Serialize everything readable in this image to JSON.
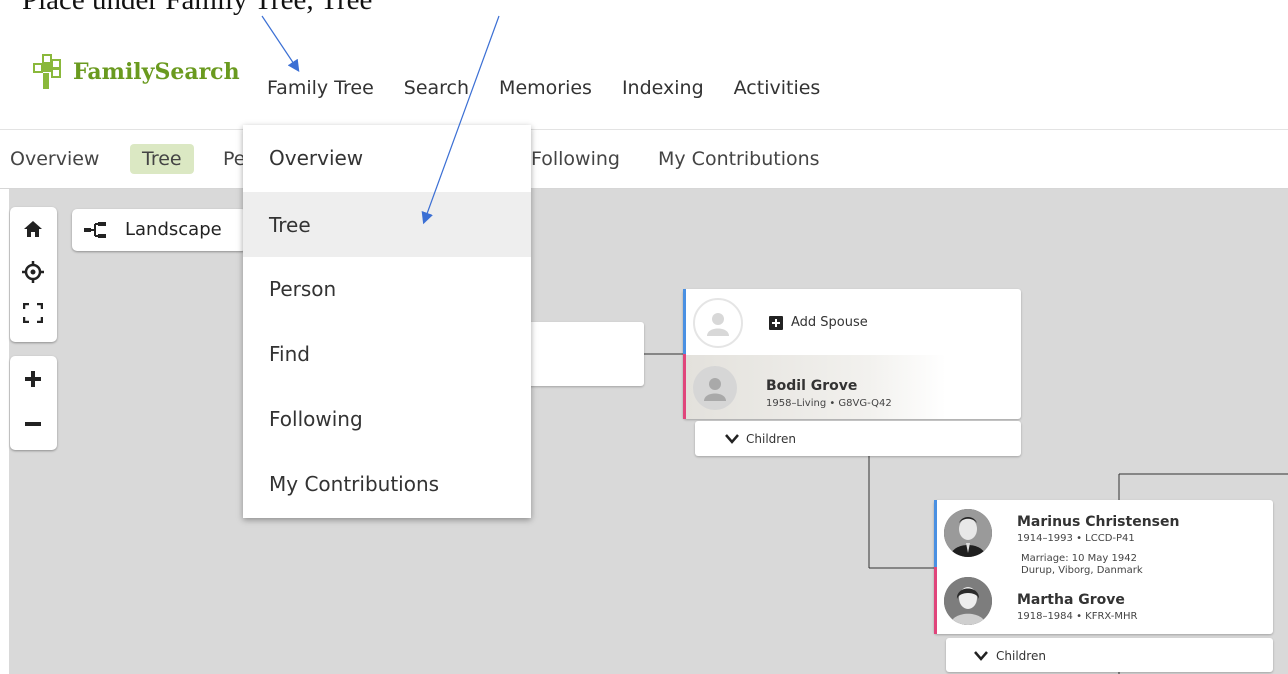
{
  "instruction": "Place under Family Tree, Tree",
  "logo": {
    "text": "FamilySearch"
  },
  "nav": [
    "Family Tree",
    "Search",
    "Memories",
    "Indexing",
    "Activities"
  ],
  "subnav": {
    "overview": "Overview",
    "tree": "Tree",
    "person_partial": "Pe",
    "following_partial": "Following",
    "contributions": "My Contributions"
  },
  "dropdown": [
    "Overview",
    "Tree",
    "Person",
    "Find",
    "Following",
    "My Contributions"
  ],
  "controls": {
    "landscape": "Landscape"
  },
  "tree": {
    "add_spouse": "Add Spouse",
    "person1": {
      "name": "Bodil Grove",
      "meta": "1958–Living • G8VG-Q42"
    },
    "children1": "Children",
    "person2": {
      "name": "Marinus Christensen",
      "meta": "1914–1993 • LCCD-P41"
    },
    "marriage_line1": "Marriage: 10 May 1942",
    "marriage_line2": "Durup, Viborg, Danmark",
    "person3": {
      "name": "Martha Grove",
      "meta": "1918–1984 • KFRX-MHR"
    },
    "children2": "Children"
  },
  "colors": {
    "male": "#4a90e2",
    "female": "#e0457b",
    "accent": "#6a9a1f",
    "arrow": "#3b6fd4"
  }
}
